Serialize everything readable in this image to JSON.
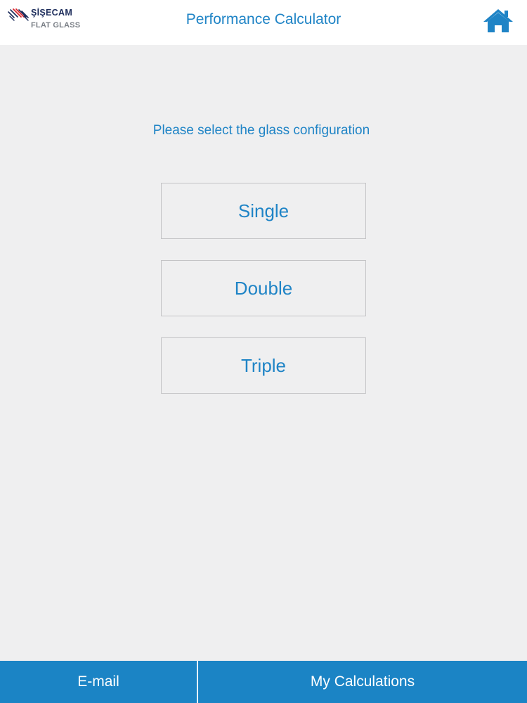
{
  "header": {
    "logo": {
      "brand": "ŞİŞECAM",
      "sub": "FLAT GLASS",
      "icon": "sisecam-logo-mark"
    },
    "title": "Performance Calculator",
    "home_icon": "home-icon"
  },
  "main": {
    "prompt": "Please select the glass configuration",
    "options": [
      {
        "label": "Single"
      },
      {
        "label": "Double"
      },
      {
        "label": "Triple"
      }
    ]
  },
  "footer": {
    "email_label": "E-mail",
    "calculations_label": "My Calculations"
  },
  "colors": {
    "accent": "#1f84c6",
    "footer_bg": "#1b84c5",
    "page_bg": "#efeff0",
    "header_bg": "#ffffff",
    "logo_red": "#d7262e"
  }
}
